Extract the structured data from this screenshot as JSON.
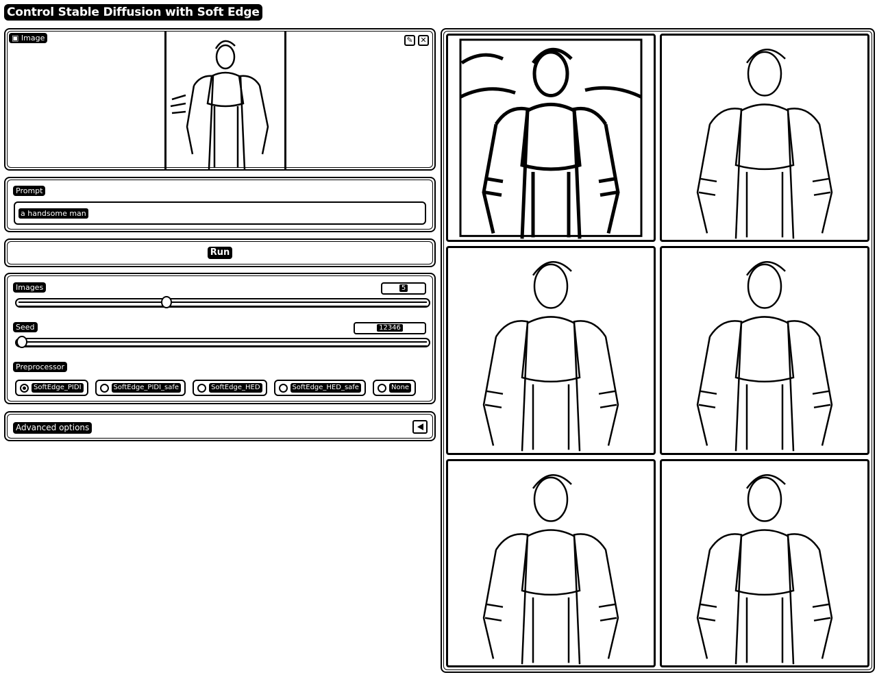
{
  "app": {
    "title": "Control Stable Diffusion with Soft Edge"
  },
  "image_input": {
    "label": "Image",
    "edit_icon": "pencil-icon",
    "clear_icon": "close-icon",
    "preview": "uploaded photo of a man in a hoodie and coat"
  },
  "prompt": {
    "label": "Prompt",
    "value": "a handsome man"
  },
  "run": {
    "label": "Run"
  },
  "settings": {
    "images": {
      "label": "Images",
      "value": "5",
      "fraction": 0.36
    },
    "seed": {
      "label": "Seed",
      "value": "12346",
      "fraction": 0.0
    },
    "preprocessor": {
      "label": "Preprocessor",
      "options": [
        "SoftEdge_PIDI",
        "SoftEdge_PIDI_safe",
        "SoftEdge_HED",
        "SoftEdge_HED_safe",
        "None"
      ],
      "selected": "SoftEdge_PIDI"
    }
  },
  "advanced": {
    "label": "Advanced options",
    "icon": "collapse-arrow-icon"
  },
  "gallery": {
    "items": [
      {
        "kind": "soft-edge map"
      },
      {
        "kind": "generated image"
      },
      {
        "kind": "generated image"
      },
      {
        "kind": "generated image"
      },
      {
        "kind": "generated image"
      },
      {
        "kind": "generated image"
      }
    ]
  }
}
